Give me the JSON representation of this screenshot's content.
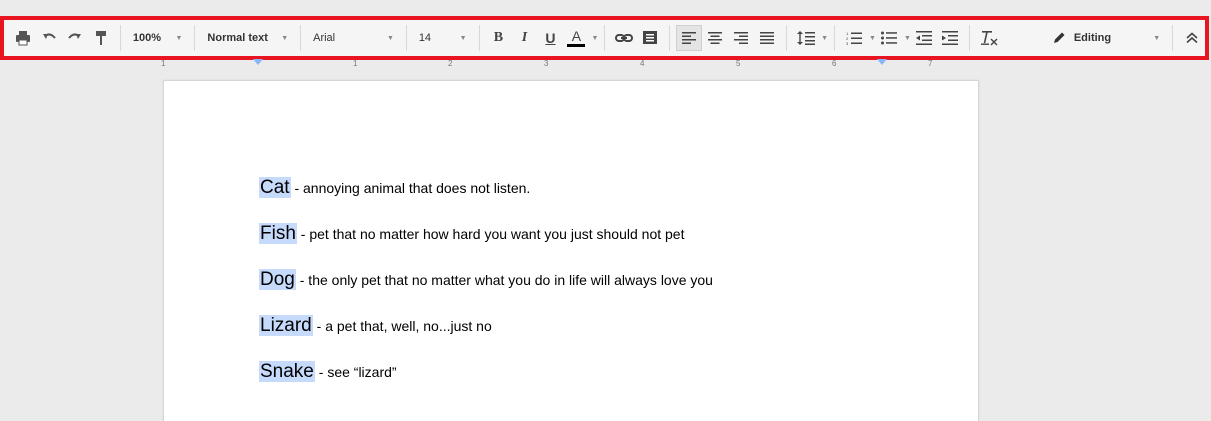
{
  "toolbar": {
    "zoom": "100%",
    "style": "Normal text",
    "font": "Arial",
    "font_size": "14",
    "bold": "B",
    "italic": "I",
    "underline": "U",
    "text_color": "A",
    "mode": "Editing",
    "accent_color": "#e8141f"
  },
  "ruler": {
    "ticks": [
      "1",
      "1",
      "2",
      "3",
      "4",
      "5",
      "6",
      "7"
    ]
  },
  "document": {
    "lines": [
      {
        "term": "Cat",
        "desc": " - annoying animal that does not listen."
      },
      {
        "term": "Fish",
        "desc": " - pet that no matter how hard you want you just should not pet"
      },
      {
        "term": "Dog",
        "desc": " - the only pet that no matter what you do in life will always love you"
      },
      {
        "term": "Lizard",
        "desc": " - a pet that, well, no...just no"
      },
      {
        "term": "Snake",
        "desc": " - see “lizard”"
      }
    ],
    "highlight_color": "#c6dafc"
  }
}
